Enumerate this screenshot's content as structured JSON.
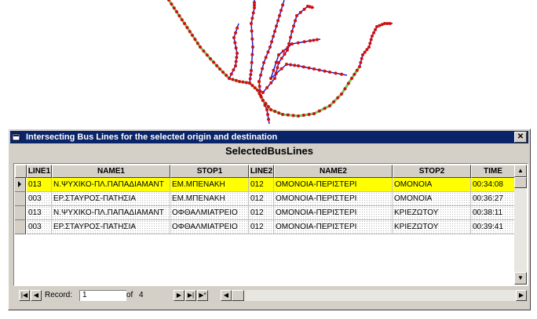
{
  "window": {
    "title": "Intersecting Bus Lines for the selected origin and destination",
    "close_label": "✕",
    "form_title": "SelectedBusLines"
  },
  "grid": {
    "columns": [
      "LINE1",
      "NAME1",
      "STOP1",
      "LINE2",
      "NAME2",
      "STOP2",
      "TIME"
    ],
    "rows": [
      {
        "line1": "013",
        "name1": "Ν.ΨΥΧΙΚΟ-ΠΛ.ΠΑΠΑΔΙΑΜΑΝΤ",
        "stop1": "ΕΜ.ΜΠΕΝΑΚΗ",
        "line2": "012",
        "name2": "ΟΜΟΝΟΙΑ-ΠΕΡΙΣΤΕΡΙ",
        "stop2": "ΟΜΟΝΟΙΑ",
        "time": "00:34:08"
      },
      {
        "line1": "003",
        "name1": "ΕΡ.ΣΤΑΥΡΟΣ-ΠΑΤΗΣΙΑ",
        "stop1": "ΕΜ.ΜΠΕΝΑΚΗ",
        "line2": "012",
        "name2": "ΟΜΟΝΟΙΑ-ΠΕΡΙΣΤΕΡΙ",
        "stop2": "ΟΜΟΝΟΙΑ",
        "time": "00:36:27"
      },
      {
        "line1": "013",
        "name1": "Ν.ΨΥΧΙΚΟ-ΠΛ.ΠΑΠΑΔΙΑΜΑΝΤ",
        "stop1": "ΟΦΘΑΛΜΙΑΤΡΕΙΟ",
        "line2": "012",
        "name2": "ΟΜΟΝΟΙΑ-ΠΕΡΙΣΤΕΡΙ",
        "stop2": "ΚΡΙΕΖΩΤΟΥ",
        "time": "00:38:11"
      },
      {
        "line1": "003",
        "name1": "ΕΡ.ΣΤΑΥΡΟΣ-ΠΑΤΗΣΙΑ",
        "stop1": "ΟΦΘΑΛΜΙΑΤΡΕΙΟ",
        "line2": "012",
        "name2": "ΟΜΟΝΟΙΑ-ΠΕΡΙΣΤΕΡΙ",
        "stop2": "ΚΡΙΕΖΩΤΟΥ",
        "time": "00:39:41"
      }
    ]
  },
  "navigation": {
    "record_label": "Record:",
    "current_record": "1",
    "of_label": "of",
    "total_records": "4"
  },
  "colors": {
    "selected_row": "#ffff00",
    "route_blue": "#1f1fcf",
    "route_green": "#6fcf5f",
    "stop_red": "#d01010",
    "titlebar": "#0a246a"
  }
}
